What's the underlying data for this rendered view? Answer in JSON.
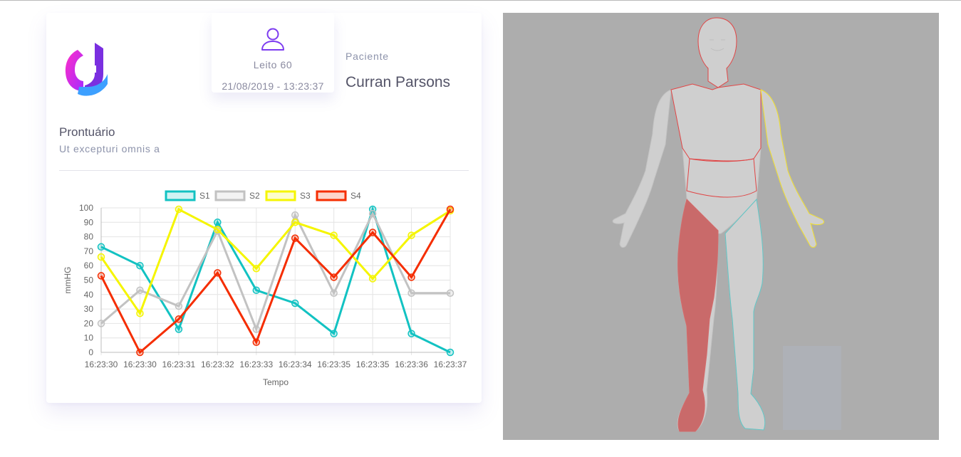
{
  "header": {
    "bed_label": "Leito 60",
    "timestamp": "21/08/2019 - 13:23:37",
    "patient_caption": "Paciente",
    "patient_name": "Curran Parsons",
    "icons": {
      "logo": "hospital-logo",
      "bed": "user-icon"
    }
  },
  "record": {
    "title": "Prontuário",
    "subtitle": "Ut excepturi omnis a"
  },
  "colors": {
    "accent": "#7d3cf0",
    "S1": "#12c2c2",
    "S2": "#c2c2c2",
    "S3": "#f5f500",
    "S4": "#f52d00",
    "body_highlight_red": "#c96a6a",
    "body_outline_yellow": "#f2e02a",
    "body_outline_cyan": "#5ec7c7",
    "body_outline_red": "#e04545"
  },
  "chart_data": {
    "type": "line",
    "xlabel": "Tempo",
    "ylabel": "mmHG",
    "ylim": [
      0,
      100
    ],
    "yticks": [
      0,
      10,
      20,
      30,
      40,
      50,
      60,
      70,
      80,
      90,
      100
    ],
    "categories": [
      "16:23:30",
      "16:23:30",
      "16:23:31",
      "16:23:32",
      "16:23:33",
      "16:23:34",
      "16:23:35",
      "16:23:35",
      "16:23:36",
      "16:23:37"
    ],
    "legend_position": "top",
    "grid": true,
    "series": [
      {
        "name": "S1",
        "color": "#12c2c2",
        "values": [
          73,
          60,
          16,
          90,
          43,
          34,
          13,
          99,
          13,
          0
        ]
      },
      {
        "name": "S2",
        "color": "#c2c2c2",
        "values": [
          20,
          43,
          32,
          84,
          16,
          95,
          41,
          96,
          41,
          41
        ]
      },
      {
        "name": "S3",
        "color": "#f5f500",
        "values": [
          66,
          27,
          99,
          85,
          58,
          90,
          81,
          51,
          81,
          98
        ]
      },
      {
        "name": "S4",
        "color": "#f52d00",
        "values": [
          53,
          0,
          23,
          55,
          7,
          79,
          52,
          83,
          52,
          99
        ]
      }
    ]
  },
  "body_map": {
    "highlighted_regions": [
      "head",
      "torso",
      "left-arm",
      "right-leg"
    ]
  }
}
